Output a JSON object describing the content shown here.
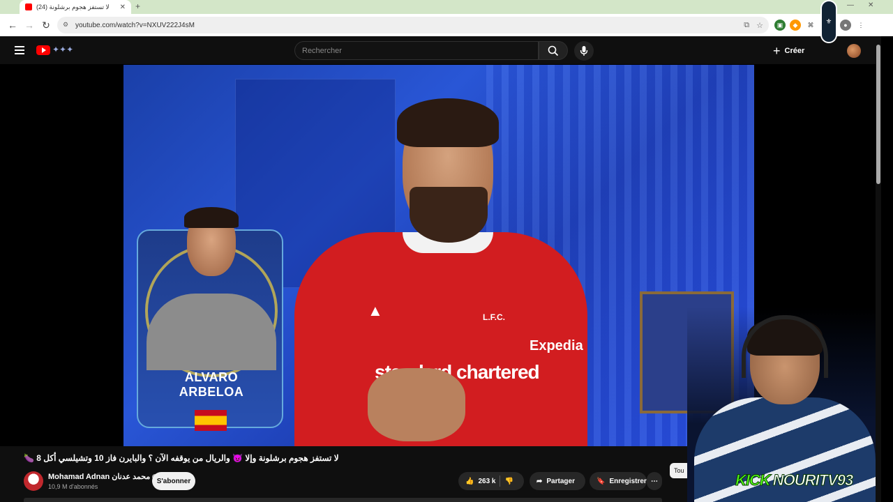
{
  "browser": {
    "tab_title": "لا تستفز هجوم برشلونة (24)",
    "url": "youtube.com/watch?v=NXUV222J4sM"
  },
  "header": {
    "search_placeholder": "Rechercher",
    "create_label": "Créer"
  },
  "video": {
    "card_name_line1": "ALVARO",
    "card_name_line2": "ARBELOA",
    "shirt_sponsor": "standard chartered",
    "shirt_sleeve": "Expedia",
    "shirt_crest": "L.F.C.",
    "title": "لا تستفز هجوم برشلونة وإلا 😈 والريال من يوقفه الآن ؟ والبايرن فاز 10 وتشيلسي أكل 8 🍆"
  },
  "channel": {
    "name": "Mohamad Adnan محمد عدنان",
    "subscribers": "10,9 M d'abonnés",
    "subscribe_label": "S'abonner"
  },
  "actions": {
    "likes": "263 k",
    "share_label": "Partager",
    "save_label": "Enregistrer"
  },
  "sidebar_chip": "Tou",
  "overlay": {
    "kick_logo": "KICK",
    "streamer_name": "NOURITV93"
  },
  "colors": {
    "youtube_red": "#ff0000",
    "kick_green": "#53fc18",
    "background": "#0f0f0f"
  }
}
